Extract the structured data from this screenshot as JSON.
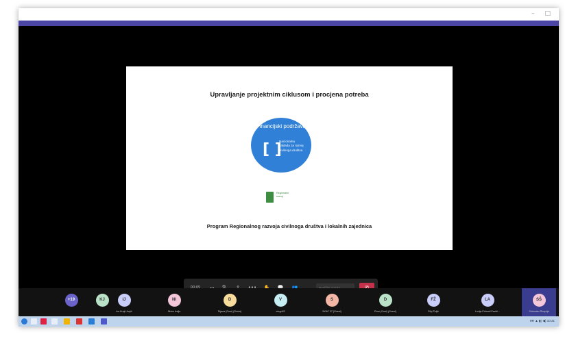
{
  "window": {
    "controls": "–  □"
  },
  "slide": {
    "title": "Upravljanje projektnim ciklusom i procjena potreba",
    "circle_title": "Financijski podržava",
    "bracket": "[ ]",
    "circle_sub": "Nacionalna zaklada za razvoj civilnoga društva",
    "logo_text": "Regionalni razvoj",
    "footer": "Program Regionalnog razvoja civilnoga društva i lokalnih zajednica"
  },
  "presenter": {
    "name": "Slobodan Škuprija"
  },
  "controls": {
    "timer": "00:05",
    "camera_icon": "▭",
    "mic_icon": "🎙",
    "share_icon": "⇪",
    "more_icon": "•••",
    "raise_hand_icon": "✋",
    "chat_icon": "💬",
    "people_icon": "👥",
    "composer_placeholder": "Napišite poruku",
    "hangup_icon": "✆",
    "hangup_color": "#c4314b"
  },
  "participants": [
    {
      "initials": "+19",
      "name": "",
      "color": "#6b63c9"
    },
    {
      "initials": "KJ",
      "name": "",
      "color": "#b9e2c8"
    },
    {
      "initials": "IJ",
      "name": "Iva Krajč Jurjić",
      "color": "#c9cdfa"
    },
    {
      "initials": "NI",
      "name": "Nives Ivelja",
      "color": "#f3c6d9"
    },
    {
      "initials": "D",
      "name": "Dijana (Gost) (Guest)",
      "color": "#f7dc9c"
    },
    {
      "initials": "V",
      "name": "vergo53",
      "color": "#c6edf2"
    },
    {
      "initials": "S",
      "name": "SKAC 37 (Guest)",
      "color": "#f3b6a4"
    },
    {
      "initials": "D",
      "name": "Đuro (Gost) (Guest)",
      "color": "#b9e2c8"
    },
    {
      "initials": "FŽ",
      "name": "Filip Žuljić",
      "color": "#c9cdfa"
    },
    {
      "initials": "LA",
      "name": "Lucija Potrosli Pavlić...",
      "color": "#c9cdfa"
    },
    {
      "initials": "SŠ",
      "name": "Slobodan Škuprija",
      "color": "#f3c6d9"
    }
  ],
  "taskbar": {
    "tray": "HR  ▲  ◧  ◀)  10:21"
  }
}
